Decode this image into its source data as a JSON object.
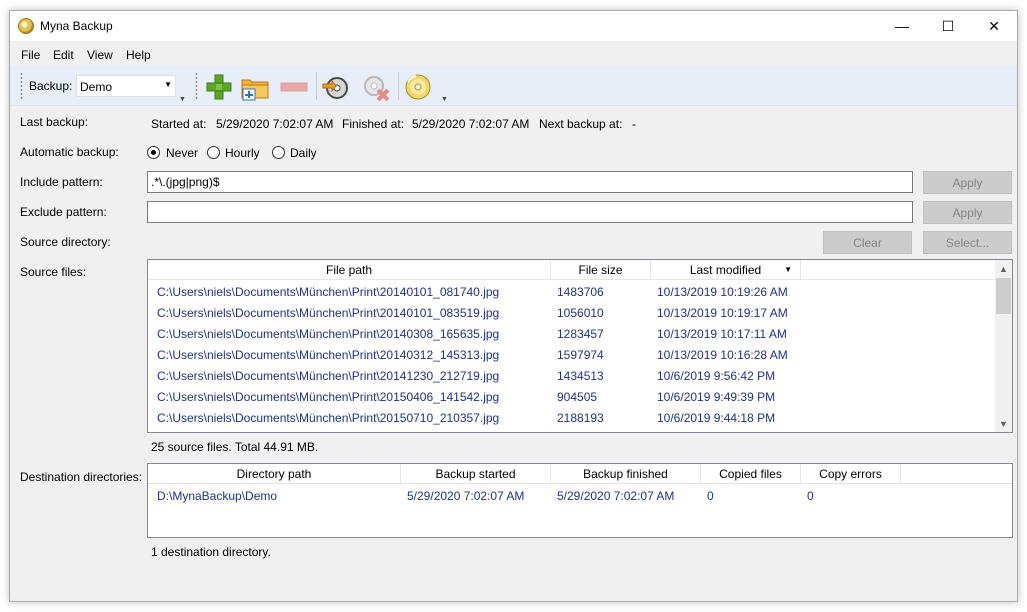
{
  "window": {
    "title": "Myna Backup",
    "minimize_symbol": "—",
    "maximize_symbol": "☐",
    "close_symbol": "✕"
  },
  "menu": [
    "File",
    "Edit",
    "View",
    "Help"
  ],
  "toolbar": {
    "backup_label": "Backup:",
    "backup_value": "Demo",
    "buttons": [
      {
        "name": "add-icon"
      },
      {
        "name": "add-folder-icon"
      },
      {
        "name": "remove-icon"
      },
      {
        "name": "run-backup-icon"
      },
      {
        "name": "cancel-backup-icon"
      },
      {
        "name": "disc-icon"
      }
    ]
  },
  "last_backup": {
    "label": "Last backup:",
    "started_label": "Started at:",
    "started_value": "5/29/2020 7:02:07 AM",
    "finished_label": "Finished at:",
    "finished_value": "5/29/2020 7:02:07 AM",
    "next_label": "Next backup at:",
    "next_value": "-"
  },
  "automatic_backup": {
    "label": "Automatic backup:",
    "options": [
      "Never",
      "Hourly",
      "Daily"
    ],
    "selected": "Never"
  },
  "include": {
    "label": "Include pattern:",
    "value": ".*\\.(jpg|png)$",
    "apply_label": "Apply"
  },
  "exclude": {
    "label": "Exclude pattern:",
    "value": "",
    "apply_label": "Apply"
  },
  "source_directory": {
    "label": "Source directory:",
    "clear_label": "Clear",
    "select_label": "Select..."
  },
  "source_files": {
    "label": "Source files:",
    "columns": [
      "File path",
      "File size",
      "Last modified"
    ],
    "sort_indicator": "▼",
    "rows": [
      [
        "C:\\Users\\niels\\Documents\\München\\Print\\20140101_081740.jpg",
        "1483706",
        "10/13/2019 10:19:26 AM"
      ],
      [
        "C:\\Users\\niels\\Documents\\München\\Print\\20140101_083519.jpg",
        "1056010",
        "10/13/2019 10:19:17 AM"
      ],
      [
        "C:\\Users\\niels\\Documents\\München\\Print\\20140308_165635.jpg",
        "1283457",
        "10/13/2019 10:17:11 AM"
      ],
      [
        "C:\\Users\\niels\\Documents\\München\\Print\\20140312_145313.jpg",
        "1597974",
        "10/13/2019 10:16:28 AM"
      ],
      [
        "C:\\Users\\niels\\Documents\\München\\Print\\20141230_212719.jpg",
        "1434513",
        "10/6/2019 9:56:42 PM"
      ],
      [
        "C:\\Users\\niels\\Documents\\München\\Print\\20150406_141542.jpg",
        "904505",
        "10/6/2019 9:49:39 PM"
      ],
      [
        "C:\\Users\\niels\\Documents\\München\\Print\\20150710_210357.jpg",
        "2188193",
        "10/6/2019 9:44:18 PM"
      ]
    ],
    "status": "25 source files. Total 44.91 MB."
  },
  "destination": {
    "label": "Destination directories:",
    "columns": [
      "Directory path",
      "Backup started",
      "Backup finished",
      "Copied files",
      "Copy errors"
    ],
    "rows": [
      [
        "D:\\MynaBackup\\Demo",
        "5/29/2020 7:02:07 AM",
        "5/29/2020 7:02:07 AM",
        "0",
        "0"
      ]
    ],
    "status": "1 destination directory."
  }
}
